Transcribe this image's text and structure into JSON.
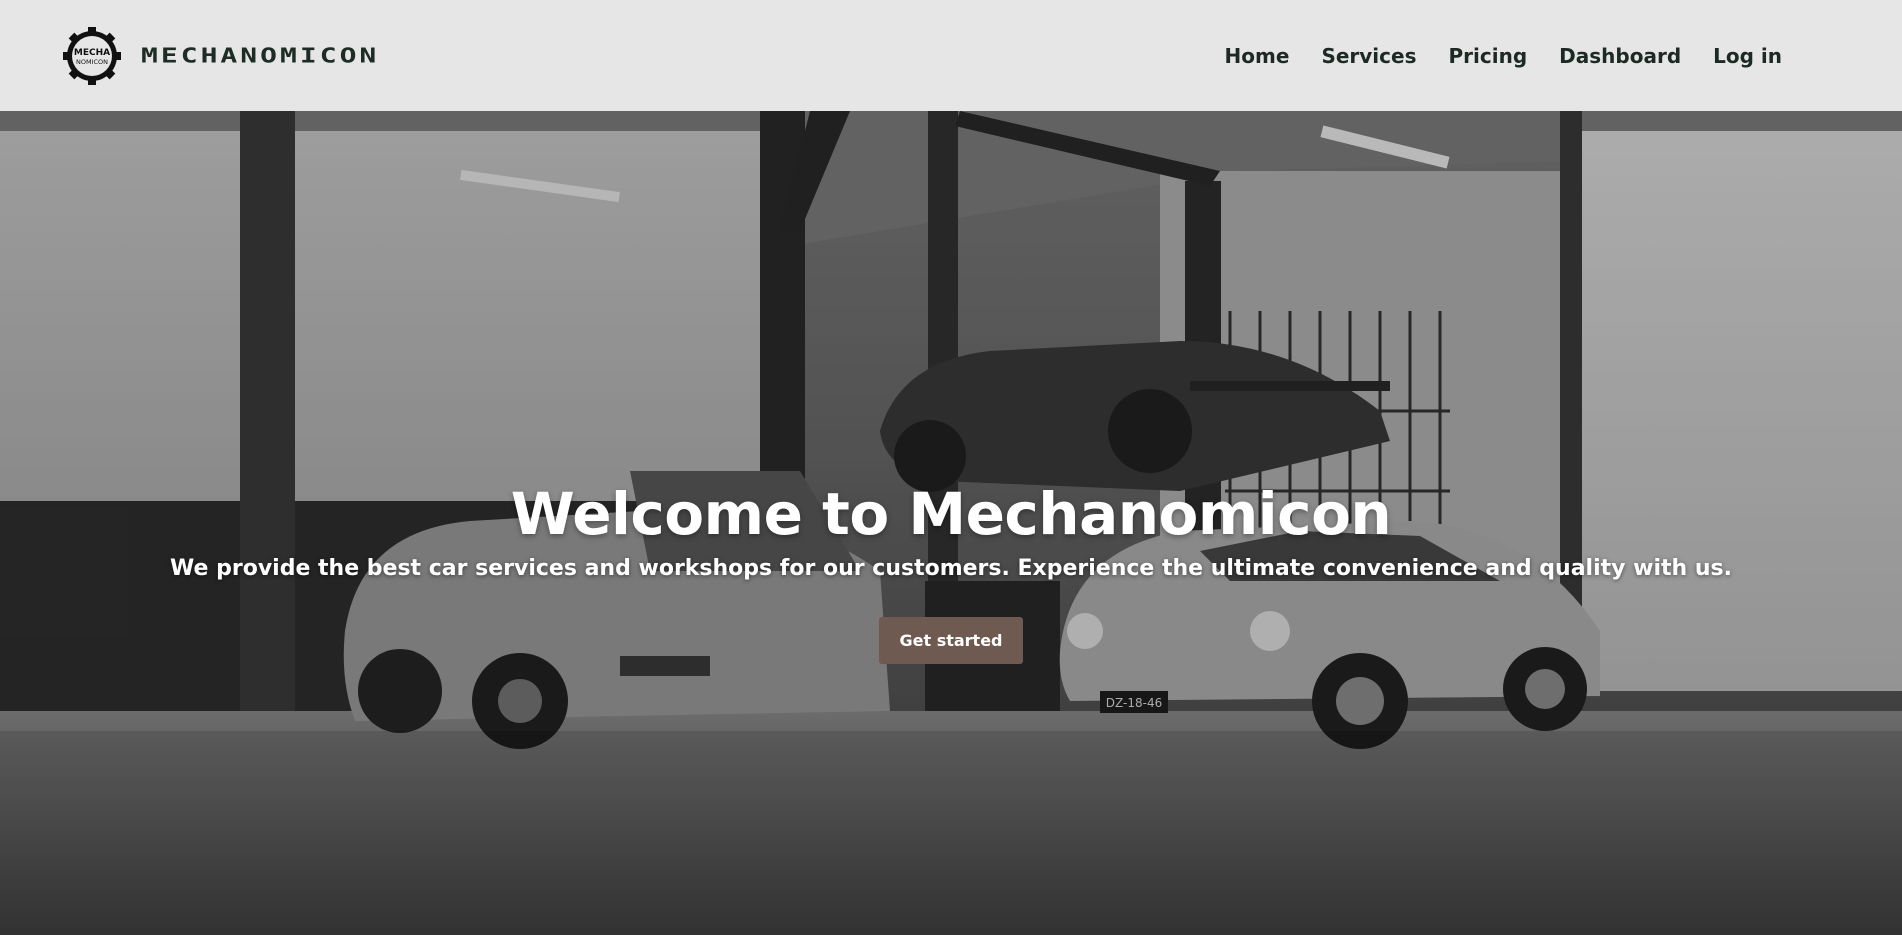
{
  "brand": {
    "badge_line1": "MECHA",
    "badge_line2": "NOMICON",
    "wordmark": "MECHANOMICON"
  },
  "nav": {
    "items": [
      {
        "label": "Home"
      },
      {
        "label": "Services"
      },
      {
        "label": "Pricing"
      },
      {
        "label": "Dashboard"
      },
      {
        "label": "Log in"
      }
    ]
  },
  "hero": {
    "title": "Welcome to Mechanomicon",
    "subtitle": "We provide the best car services and workshops for our customers. Experience the ultimate convenience and quality with us.",
    "cta_label": "Get started",
    "plate_text": "DZ-18-46"
  },
  "colors": {
    "navbar_bg": "#e6e6e6",
    "nav_text": "#1d2a24",
    "cta_bg": "#6e5a50",
    "hero_text": "#ffffff"
  },
  "icons": [
    "gear-logo-icon"
  ]
}
